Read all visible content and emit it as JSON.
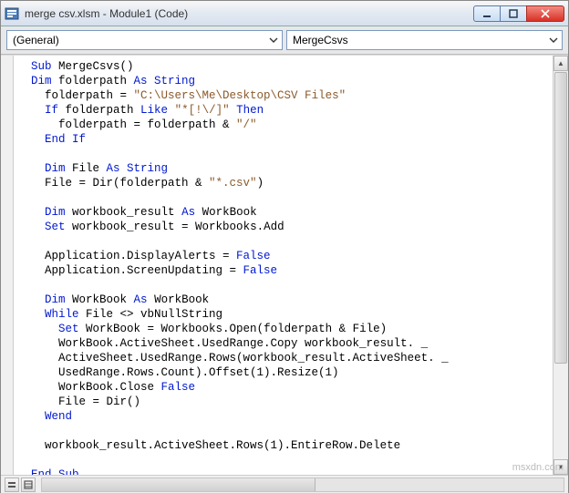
{
  "window": {
    "title": "merge csv.xlsm - Module1 (Code)"
  },
  "dropdowns": {
    "object": "(General)",
    "procedure": "MergeCsvs"
  },
  "code": {
    "lines": [
      {
        "indent": 1,
        "tokens": [
          {
            "t": "kw",
            "v": "Sub"
          },
          {
            "t": "p",
            "v": " MergeCsvs()"
          }
        ]
      },
      {
        "indent": 1,
        "tokens": [
          {
            "t": "kw",
            "v": "Dim"
          },
          {
            "t": "p",
            "v": " folderpath "
          },
          {
            "t": "kw",
            "v": "As String"
          }
        ]
      },
      {
        "indent": 2,
        "tokens": [
          {
            "t": "p",
            "v": "folderpath = "
          },
          {
            "t": "str",
            "v": "\"C:\\Users\\Me\\Desktop\\CSV Files\""
          }
        ]
      },
      {
        "indent": 2,
        "tokens": [
          {
            "t": "kw",
            "v": "If"
          },
          {
            "t": "p",
            "v": " folderpath "
          },
          {
            "t": "kw",
            "v": "Like"
          },
          {
            "t": "p",
            "v": " "
          },
          {
            "t": "str",
            "v": "\"*[!\\/]\""
          },
          {
            "t": "p",
            "v": " "
          },
          {
            "t": "kw",
            "v": "Then"
          }
        ]
      },
      {
        "indent": 3,
        "tokens": [
          {
            "t": "p",
            "v": "folderpath = folderpath & "
          },
          {
            "t": "str",
            "v": "\"/\""
          }
        ]
      },
      {
        "indent": 2,
        "tokens": [
          {
            "t": "kw",
            "v": "End If"
          }
        ]
      },
      {
        "indent": 0,
        "tokens": [
          {
            "t": "p",
            "v": ""
          }
        ]
      },
      {
        "indent": 2,
        "tokens": [
          {
            "t": "kw",
            "v": "Dim"
          },
          {
            "t": "p",
            "v": " File "
          },
          {
            "t": "kw",
            "v": "As String"
          }
        ]
      },
      {
        "indent": 2,
        "tokens": [
          {
            "t": "p",
            "v": "File = Dir(folderpath & "
          },
          {
            "t": "str",
            "v": "\"*.csv\""
          },
          {
            "t": "p",
            "v": ")"
          }
        ]
      },
      {
        "indent": 0,
        "tokens": [
          {
            "t": "p",
            "v": ""
          }
        ]
      },
      {
        "indent": 2,
        "tokens": [
          {
            "t": "kw",
            "v": "Dim"
          },
          {
            "t": "p",
            "v": " workbook_result "
          },
          {
            "t": "kw",
            "v": "As"
          },
          {
            "t": "p",
            "v": " WorkBook"
          }
        ]
      },
      {
        "indent": 2,
        "tokens": [
          {
            "t": "kw",
            "v": "Set"
          },
          {
            "t": "p",
            "v": " workbook_result = Workbooks.Add"
          }
        ]
      },
      {
        "indent": 0,
        "tokens": [
          {
            "t": "p",
            "v": ""
          }
        ]
      },
      {
        "indent": 2,
        "tokens": [
          {
            "t": "p",
            "v": "Application.DisplayAlerts = "
          },
          {
            "t": "kw",
            "v": "False"
          }
        ]
      },
      {
        "indent": 2,
        "tokens": [
          {
            "t": "p",
            "v": "Application.ScreenUpdating = "
          },
          {
            "t": "kw",
            "v": "False"
          }
        ]
      },
      {
        "indent": 0,
        "tokens": [
          {
            "t": "p",
            "v": ""
          }
        ]
      },
      {
        "indent": 2,
        "tokens": [
          {
            "t": "kw",
            "v": "Dim"
          },
          {
            "t": "p",
            "v": " WorkBook "
          },
          {
            "t": "kw",
            "v": "As"
          },
          {
            "t": "p",
            "v": " WorkBook"
          }
        ]
      },
      {
        "indent": 2,
        "tokens": [
          {
            "t": "kw",
            "v": "While"
          },
          {
            "t": "p",
            "v": " File <> vbNullString"
          }
        ]
      },
      {
        "indent": 3,
        "tokens": [
          {
            "t": "kw",
            "v": "Set"
          },
          {
            "t": "p",
            "v": " WorkBook = Workbooks.Open(folderpath & File)"
          }
        ]
      },
      {
        "indent": 3,
        "tokens": [
          {
            "t": "p",
            "v": "WorkBook.ActiveSheet.UsedRange.Copy workbook_result. _"
          }
        ]
      },
      {
        "indent": 3,
        "tokens": [
          {
            "t": "p",
            "v": "ActiveSheet.UsedRange.Rows(workbook_result.ActiveSheet. _"
          }
        ]
      },
      {
        "indent": 3,
        "tokens": [
          {
            "t": "p",
            "v": "UsedRange.Rows.Count).Offset(1).Resize(1)"
          }
        ]
      },
      {
        "indent": 3,
        "tokens": [
          {
            "t": "p",
            "v": "WorkBook.Close "
          },
          {
            "t": "kw",
            "v": "False"
          }
        ]
      },
      {
        "indent": 3,
        "tokens": [
          {
            "t": "p",
            "v": "File = Dir()"
          }
        ]
      },
      {
        "indent": 2,
        "tokens": [
          {
            "t": "kw",
            "v": "Wend"
          }
        ]
      },
      {
        "indent": 0,
        "tokens": [
          {
            "t": "p",
            "v": ""
          }
        ]
      },
      {
        "indent": 2,
        "tokens": [
          {
            "t": "p",
            "v": "workbook_result.ActiveSheet.Rows(1).EntireRow.Delete"
          }
        ]
      },
      {
        "indent": 0,
        "tokens": [
          {
            "t": "p",
            "v": ""
          }
        ]
      },
      {
        "indent": 1,
        "tokens": [
          {
            "t": "kw",
            "v": "End Sub"
          }
        ]
      }
    ]
  },
  "watermark": "msxdn.com"
}
